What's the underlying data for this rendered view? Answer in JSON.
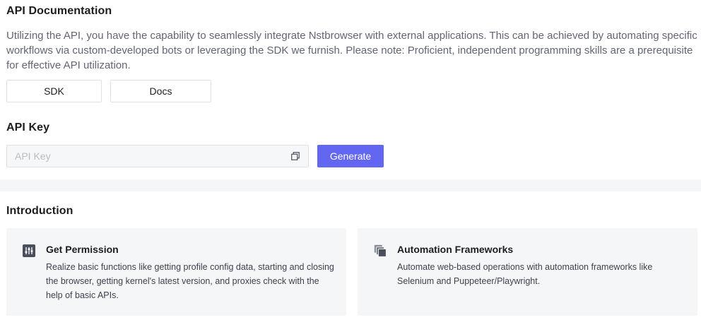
{
  "api_doc": {
    "title": "API Documentation",
    "description": "Utilizing the API, you have the capability to seamlessly integrate Nstbrowser with external applications. This can be achieved by automating specific workflows via custom-developed bots or leveraging the SDK we furnish. Please note: Proficient, independent programming skills are a prerequisite for effective API utilization.",
    "sdk_label": "SDK",
    "docs_label": "Docs"
  },
  "api_key": {
    "title": "API Key",
    "placeholder": "API Key",
    "value": "",
    "copy_icon": "copy-icon",
    "generate_label": "Generate"
  },
  "intro": {
    "title": "Introduction",
    "cards": [
      {
        "icon": "sliders-icon",
        "title": "Get Permission",
        "text": "Realize basic functions like getting profile config data, starting and closing the browser, getting kernel's latest version, and proxies check with the help of basic APIs."
      },
      {
        "icon": "layers-icon",
        "title": "Automation Frameworks",
        "text": "Automate web-based operations with automation frameworks like Selenium and Puppeteer/Playwright."
      }
    ]
  },
  "colors": {
    "accent": "#6366f1",
    "panel_bg": "#f5f6f8",
    "muted_text": "#626574",
    "icon_dark": "#4b4f5c"
  }
}
